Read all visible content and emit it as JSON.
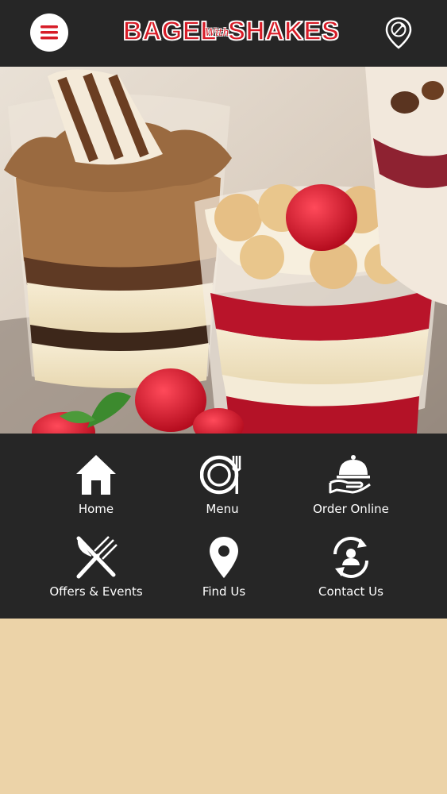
{
  "header": {
    "brand_left": "BAGEL",
    "brand_mid": "With",
    "brand_right": "SHAKES",
    "menu_icon": "hamburger-menu-icon",
    "location_icon": "map-pin-fork-knife-icon"
  },
  "colors": {
    "header_bg": "#262626",
    "brand_red": "#d71c27",
    "page_bg": "#ecd3a8",
    "panel_bg": "#262626",
    "icon_white": "#ffffff"
  },
  "menu": {
    "items": [
      {
        "label": "Home",
        "icon": "home-icon"
      },
      {
        "label": "Menu",
        "icon": "plate-cutlery-icon"
      },
      {
        "label": "Order Online",
        "icon": "serving-cloche-icon"
      },
      {
        "label": "Offers & Events",
        "icon": "crossed-cutlery-icon"
      },
      {
        "label": "Find Us",
        "icon": "map-pin-icon"
      },
      {
        "label": "Contact Us",
        "icon": "contact-refresh-icon"
      }
    ]
  }
}
